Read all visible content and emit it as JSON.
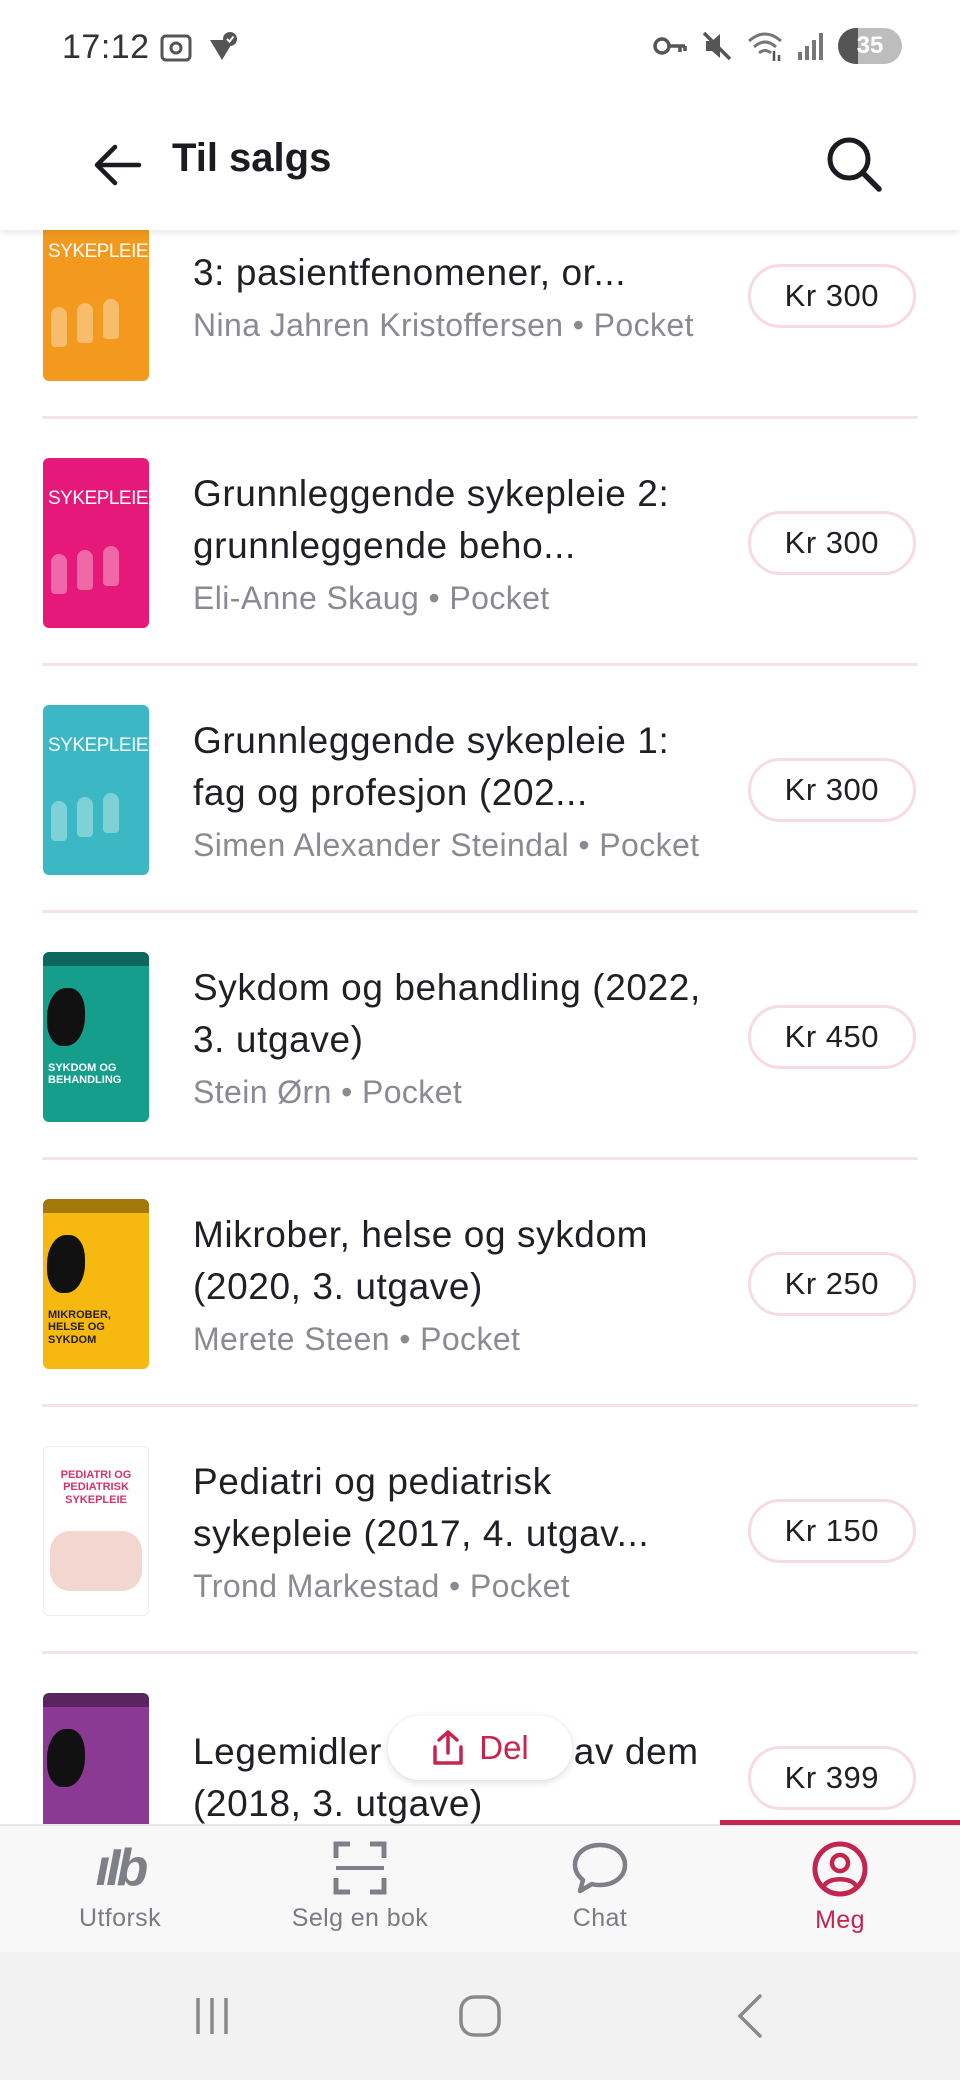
{
  "status_bar": {
    "time": "17:12",
    "battery": "35"
  },
  "header": {
    "title": "Til salgs"
  },
  "books": [
    {
      "title": "3: pasientfenomener, or...",
      "author": "Nina Jahren Kristoffersen",
      "format": "Pocket",
      "price": "Kr 300",
      "cover_color": "#f39a1e",
      "cover_label": "SYKEPLEIE"
    },
    {
      "title": "Grunnleggende sykepleie 2: grunnleggende beho...",
      "author": "Eli-Anne Skaug",
      "format": "Pocket",
      "price": "Kr 300",
      "cover_color": "#e6197a",
      "cover_label": "SYKEPLEIE"
    },
    {
      "title": "Grunnleggende sykepleie 1: fag og profesjon (202...",
      "author": "Simen Alexander Steindal",
      "format": "Pocket",
      "price": "Kr 300",
      "cover_color": "#3bb8c4",
      "cover_label": "SYKEPLEIE"
    },
    {
      "title": "Sykdom og behandling (2022, 3. utgave)",
      "author": "Stein Ørn",
      "format": "Pocket",
      "price": "Kr 450",
      "cover_color": "#169e8c",
      "cover_label": "SYKDOM OG BEHANDLING"
    },
    {
      "title": "Mikrober, helse og sykdom (2020, 3. utgave)",
      "author": "Merete Steen",
      "format": "Pocket",
      "price": "Kr 250",
      "cover_color": "#f7b90f",
      "cover_label": "MIKROBER, HELSE OG SYKDOM"
    },
    {
      "title": "Pediatri og pediatrisk sykepleie (2017, 4. utgav...",
      "author": "Trond Markestad",
      "format": "Pocket",
      "price": "Kr 150",
      "cover_color": "#ffffff",
      "cover_label": "PEDIATRI OG PEDIATRISK SYKEPLEIE"
    },
    {
      "title": "Legemidler og bruken av dem (2018, 3. utgave)",
      "author": "",
      "format": "",
      "price": "Kr 399",
      "cover_color": "#8b3a93",
      "cover_label": ""
    }
  ],
  "share_button": {
    "label": "Del"
  },
  "bottom_nav": {
    "items": [
      {
        "label": "Utforsk",
        "icon": "ib-logo-icon"
      },
      {
        "label": "Selg en bok",
        "icon": "scan-icon"
      },
      {
        "label": "Chat",
        "icon": "chat-bubble-icon"
      },
      {
        "label": "Meg",
        "icon": "profile-icon",
        "active": true
      }
    ]
  },
  "colors": {
    "accent": "#c2264f",
    "pill_border": "#f6dce2"
  }
}
